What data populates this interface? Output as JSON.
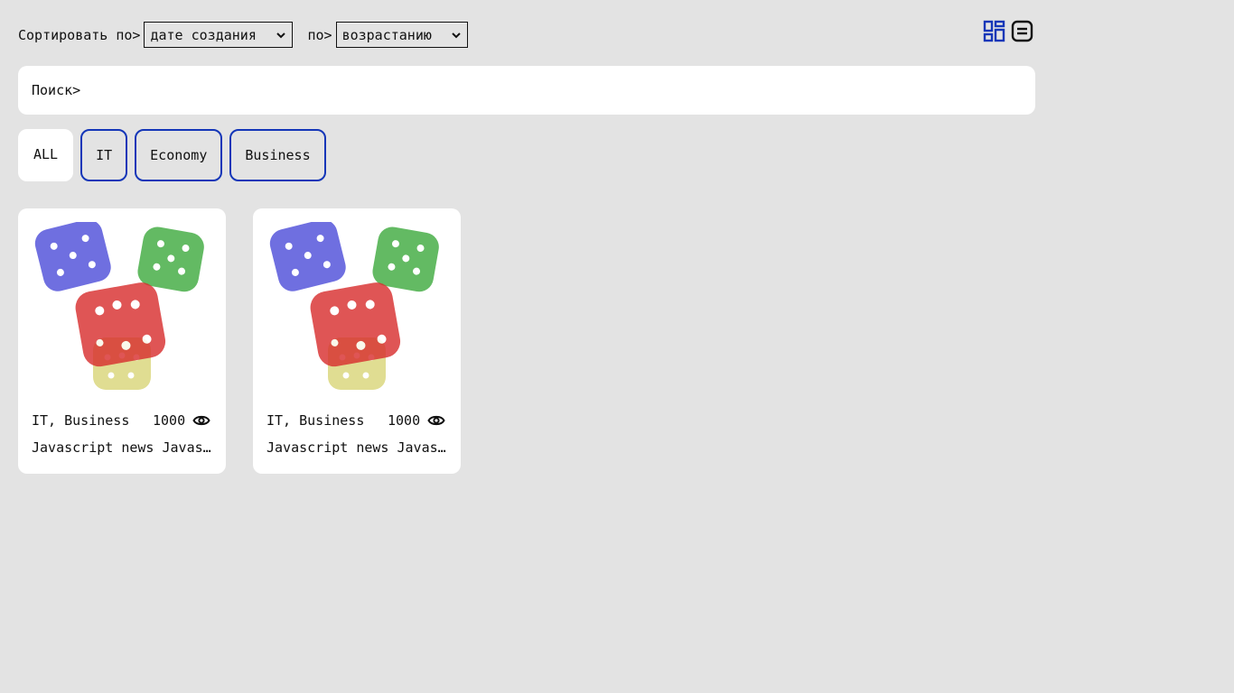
{
  "sort": {
    "label": "Сортировать по>",
    "field_value": "дате создания",
    "by_label": "по>",
    "order_value": "возрастанию"
  },
  "view": {
    "grid_icon": "grid-view-icon",
    "list_icon": "list-view-icon",
    "active_color": "#1436b8"
  },
  "search": {
    "label": "Поиск>"
  },
  "filters": [
    "ALL",
    "IT",
    "Economy",
    "Business"
  ],
  "cards": [
    {
      "tags": "IT, Business",
      "views": "1000",
      "title": "Javascript news Javascript news",
      "image": "dice-image"
    },
    {
      "tags": "IT, Business",
      "views": "1000",
      "title": "Javascript news Javascript news",
      "image": "dice-image"
    }
  ]
}
